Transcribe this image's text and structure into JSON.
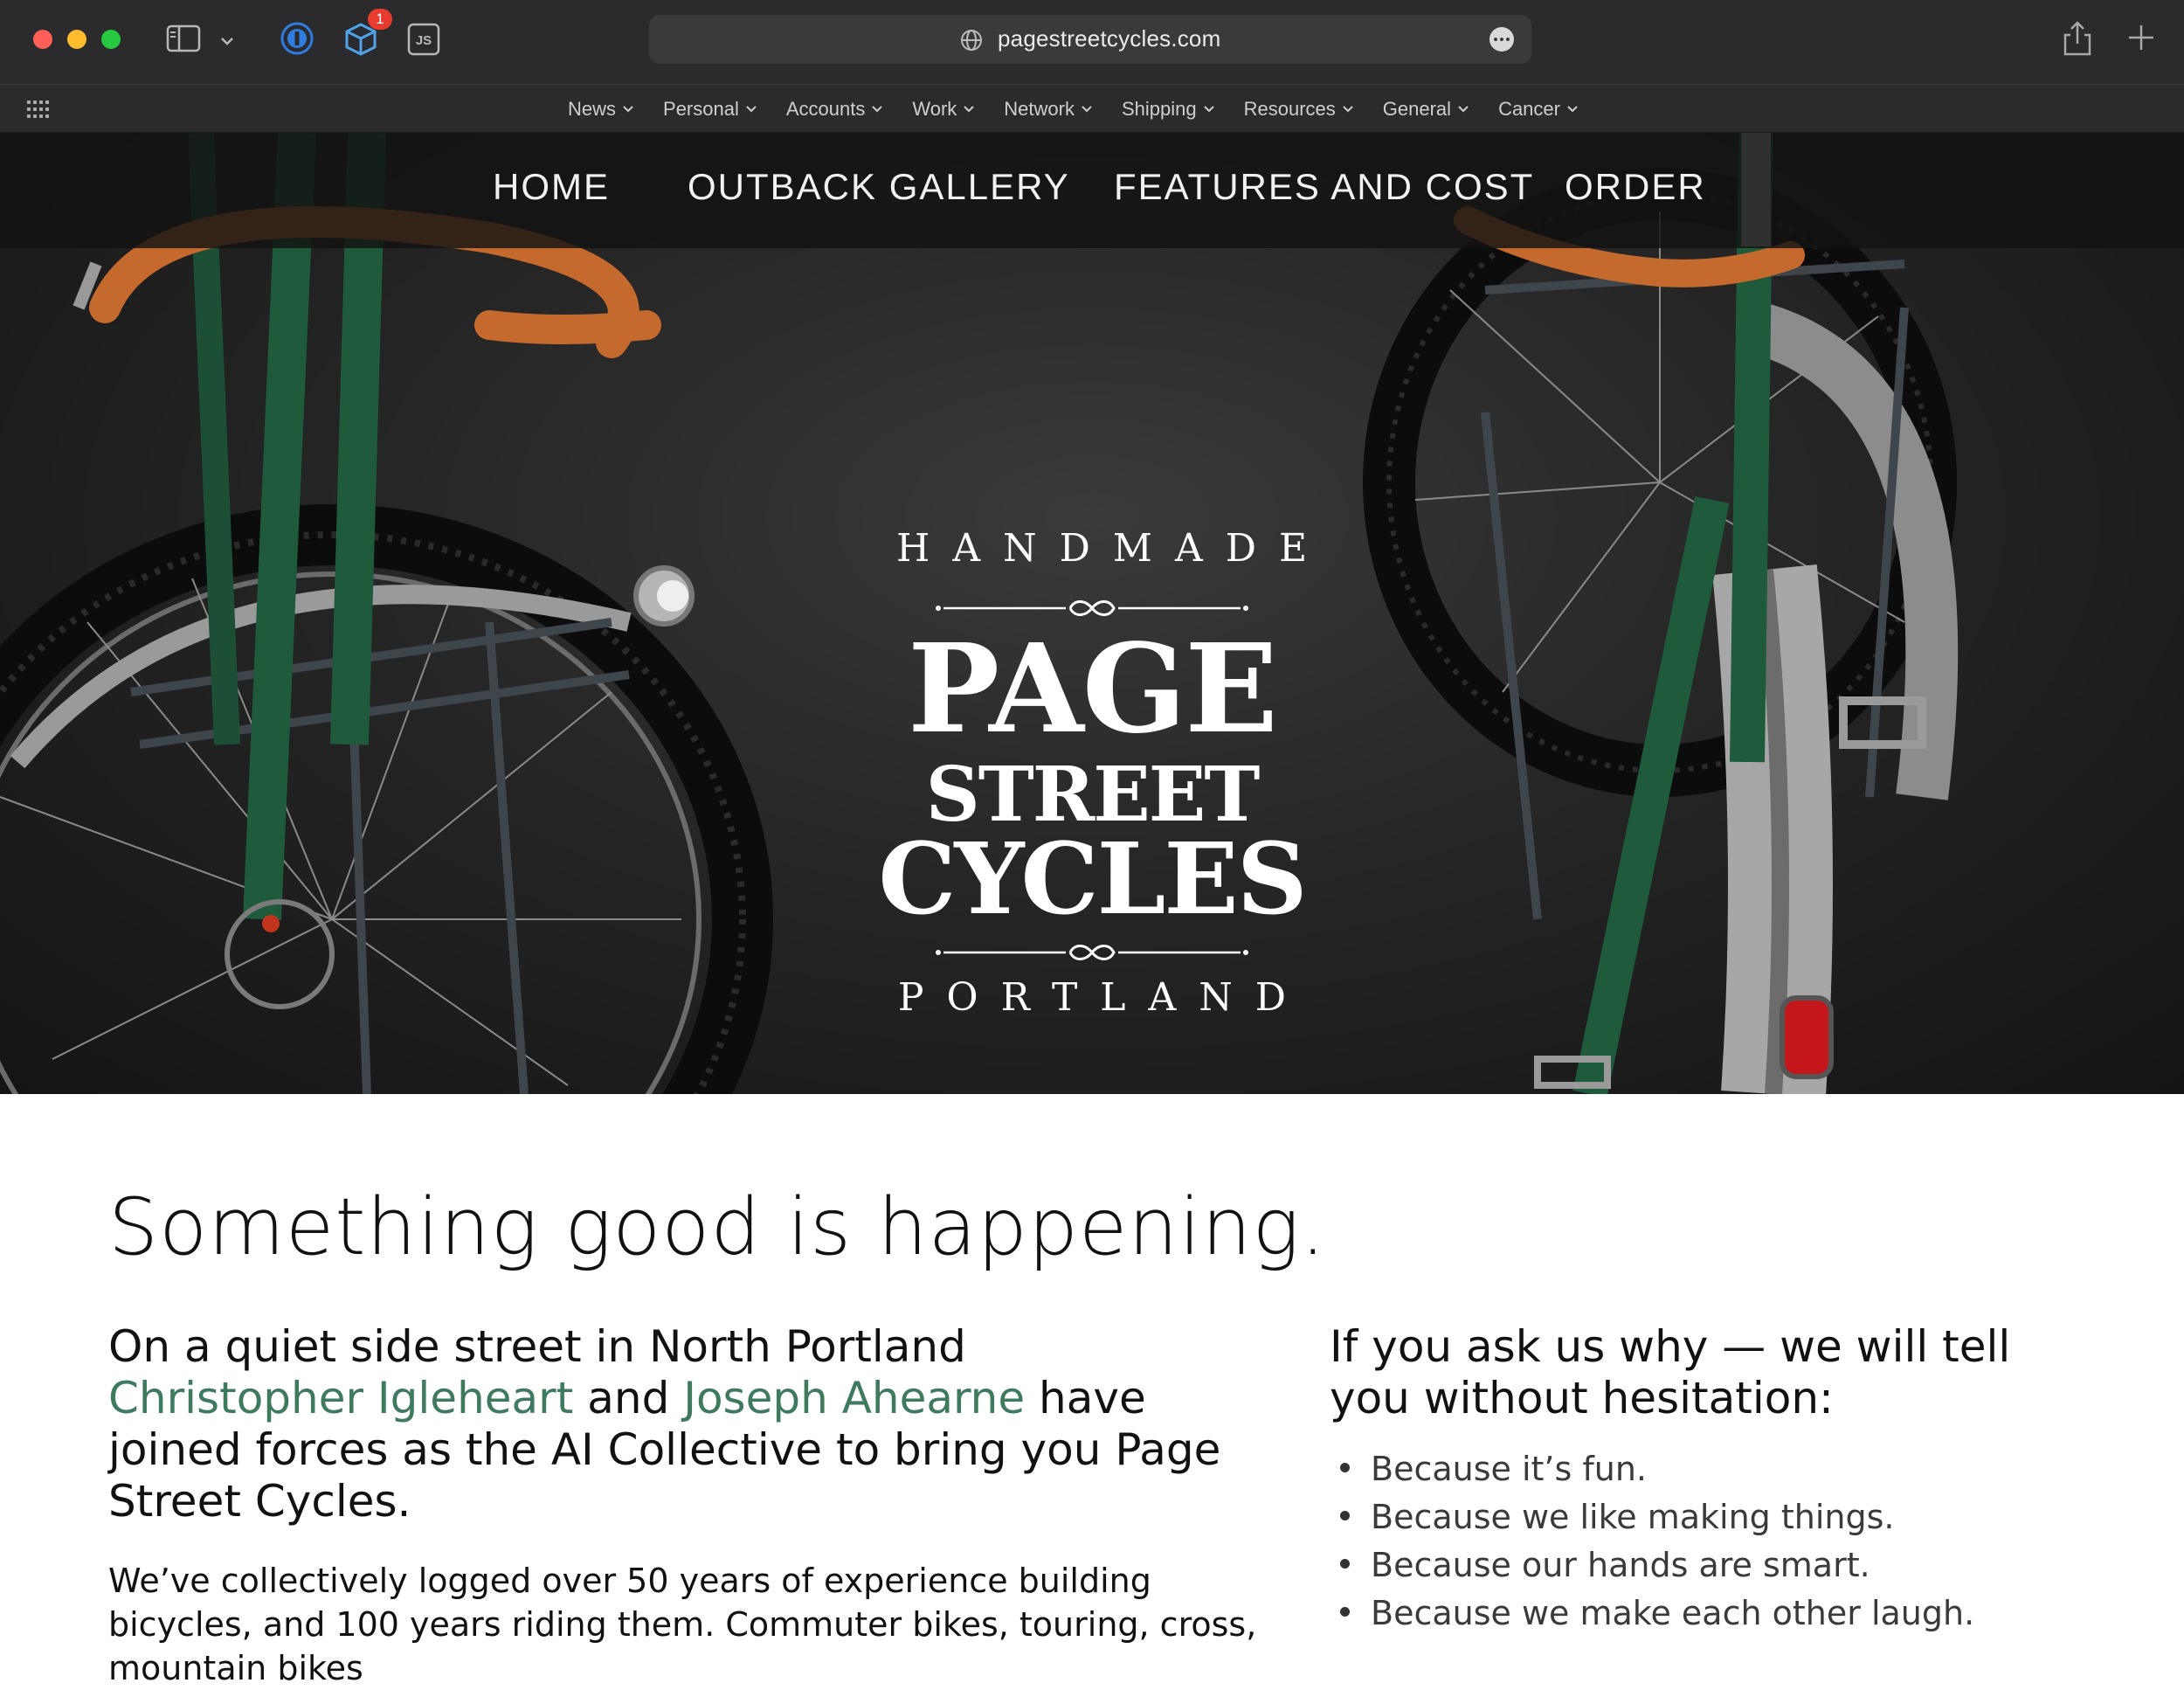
{
  "browser": {
    "url": "pagestreetcycles.com",
    "extension_badge_count": "1",
    "js_label": "JS",
    "bookmarks": [
      "News",
      "Personal",
      "Accounts",
      "Work",
      "Network",
      "Shipping",
      "Resources",
      "General",
      "Cancer"
    ]
  },
  "site_nav": {
    "home": "HOME",
    "gallery": "OUTBACK GALLERY",
    "features": "FEATURES AND COST",
    "order": "ORDER"
  },
  "logo": {
    "top": "HANDMADE",
    "line1": "PAGE",
    "line2": "STREET",
    "line3": "CYCLES",
    "bottom": "PORTLAND"
  },
  "content": {
    "headline": "Something good is happening.",
    "intro_part1": "On a quiet side street in North Portland",
    "person1": "Christopher Igleheart",
    "and": "and",
    "person2": "Joseph Ahearne",
    "intro_part2": "have joined forces as the AI Collective to bring you Page Street Cycles.",
    "paragraph": "We’ve collectively logged over 50 years of experience building bicycles, and 100 years riding them. Commuter bikes, touring, cross, mountain bikes",
    "why_heading": "If you ask us why — we will tell you without hesitation:",
    "reasons": [
      "Because it’s fun.",
      "Because we like making things.",
      "Because our hands are smart.",
      "Because we make each other laugh."
    ]
  },
  "colors": {
    "link_green": "#3e7a5d",
    "chrome_bg": "#2b2a2c",
    "frame_green": "#1f5a3d",
    "bar_tape": "#c46a2e"
  }
}
